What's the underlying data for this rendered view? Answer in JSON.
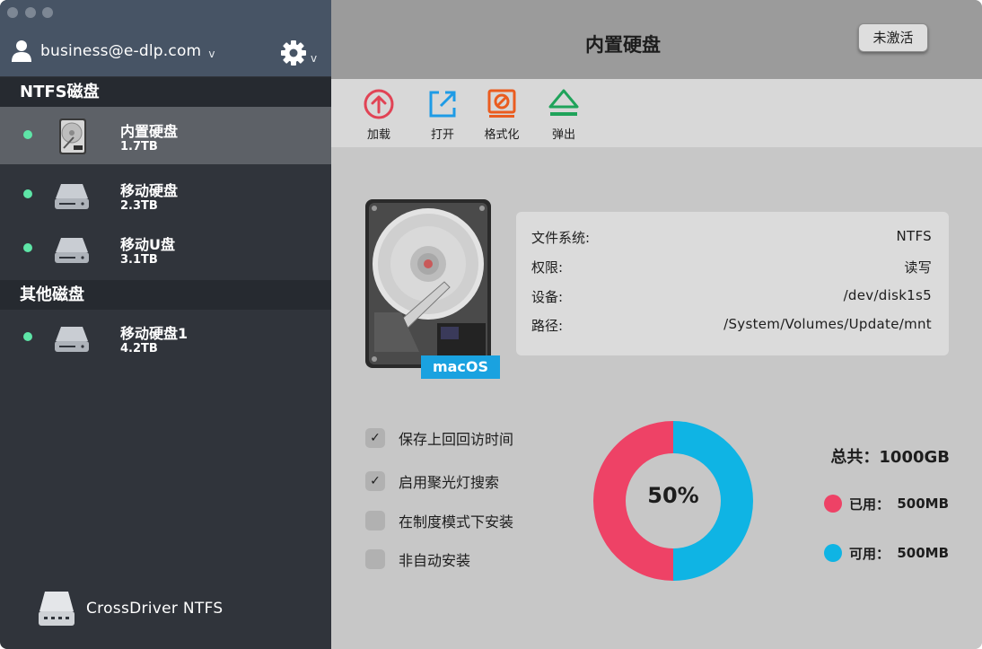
{
  "account": {
    "email": "business@e-dlp.com",
    "icon": "user-icon"
  },
  "settings": {
    "icon": "gear-icon"
  },
  "sidebar": {
    "sections": [
      {
        "title": "NTFS磁盘",
        "items": [
          {
            "name": "内置硬盘",
            "size": "1.7TB",
            "icon": "internal-hdd-icon",
            "status_color": "#5ee5a7",
            "selected": true
          },
          {
            "name": "移动硬盘",
            "size": "2.3TB",
            "icon": "external-drive-icon",
            "status_color": "#5ee5a7"
          },
          {
            "name": "移动U盘",
            "size": "3.1TB",
            "icon": "usb-drive-icon",
            "status_color": "#5ee5a7"
          }
        ]
      },
      {
        "title": "其他磁盘",
        "items": [
          {
            "name": "移动硬盘1",
            "size": "4.2TB",
            "icon": "external-drive-icon",
            "status_color": "#5ee5a7"
          }
        ]
      }
    ],
    "brand": "CrossDriver NTFS"
  },
  "main": {
    "title": "内置硬盘",
    "activate_label": "未激活",
    "toolbar": {
      "load": {
        "label": "加载",
        "icon": "mount-icon",
        "color": "#e14355"
      },
      "open": {
        "label": "打开",
        "icon": "open-external-icon",
        "color": "#1e9be6"
      },
      "format": {
        "label": "格式化",
        "icon": "format-icon",
        "color": "#ea5c1f"
      },
      "eject": {
        "label": "弹出",
        "icon": "eject-icon",
        "color": "#1fa35a"
      }
    },
    "os_badge": "macOS",
    "info": {
      "file_system": {
        "label": "文件系统:",
        "value": "NTFS"
      },
      "permission": {
        "label": "权限:",
        "value": "读写"
      },
      "device": {
        "label": "设备:",
        "value": "/dev/disk1s5"
      },
      "path": {
        "label": "路径:",
        "value": "/System/Volumes/Update/mnt"
      }
    },
    "options": [
      {
        "label": "保存上回回访时间",
        "checked": true
      },
      {
        "label": "启用聚光灯搜索",
        "checked": true
      },
      {
        "label": "在制度模式下安装",
        "checked": false
      },
      {
        "label": "非自动安装",
        "checked": false
      }
    ],
    "usage": {
      "percent_label": "50%",
      "used_fraction": 0.5,
      "total": "总共：1000GB",
      "used": {
        "label": "已用：",
        "value": "500MB",
        "color": "#ee4266"
      },
      "free": {
        "label": "可用：",
        "value": "500MB",
        "color": "#0fb4e4"
      }
    }
  }
}
